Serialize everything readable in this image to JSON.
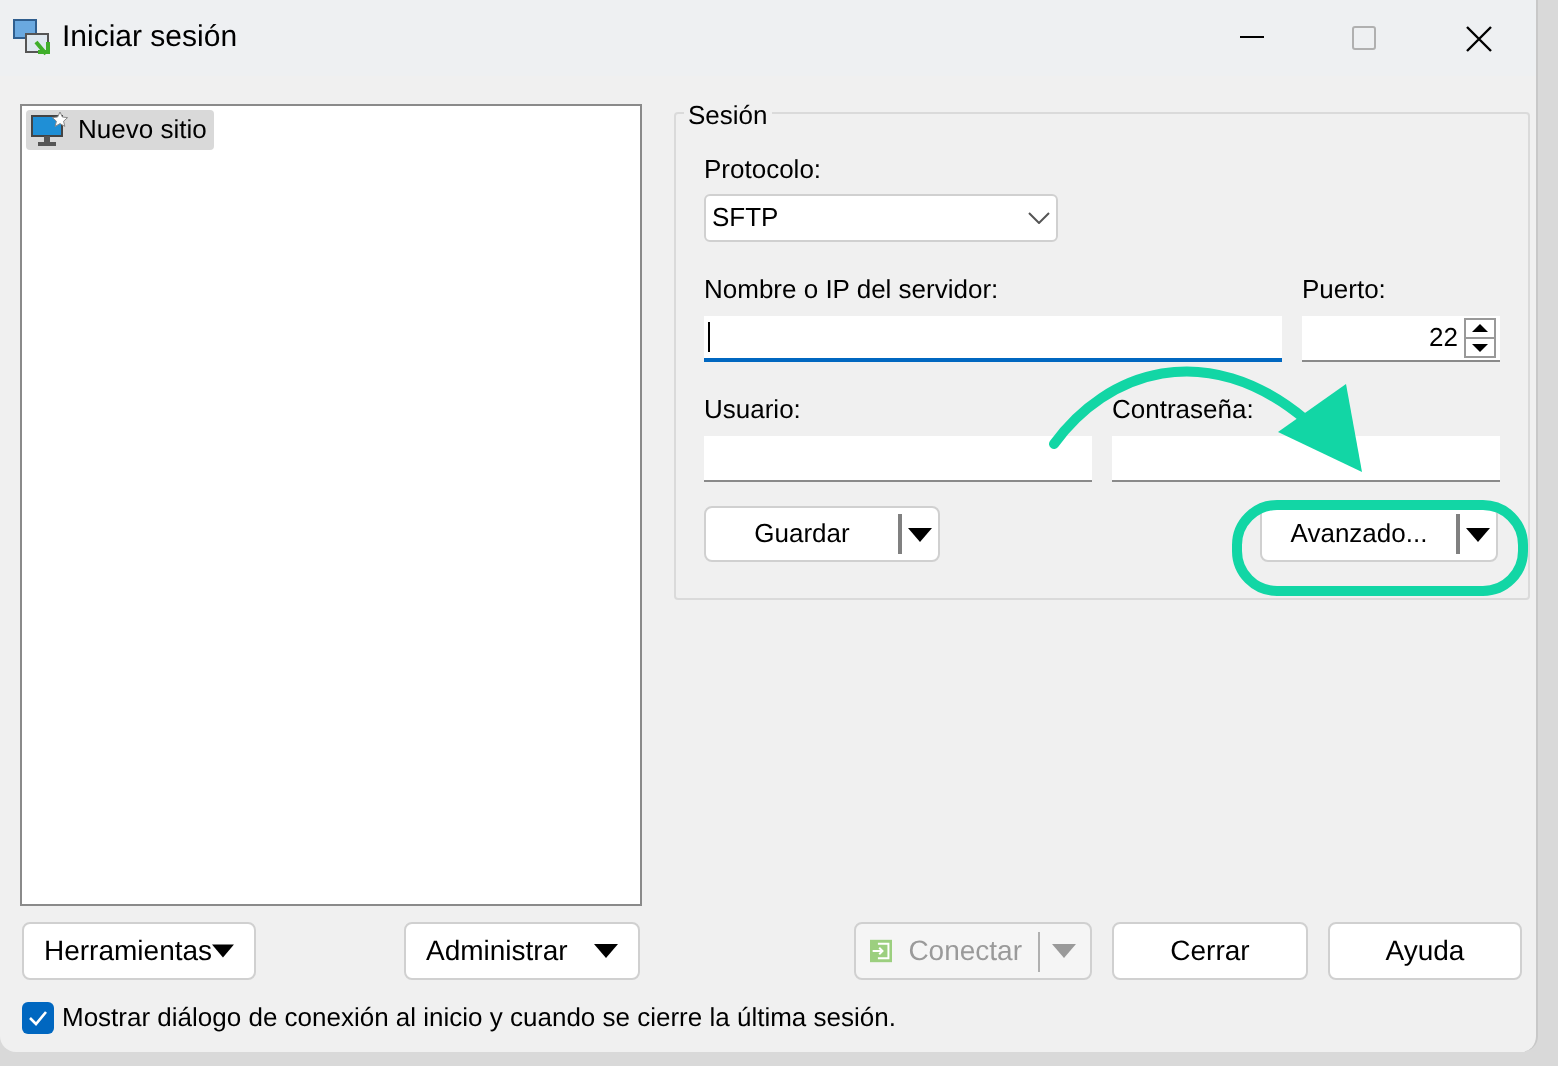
{
  "window": {
    "title": "Iniciar sesión"
  },
  "sites": [
    {
      "label": "Nuevo sitio",
      "selected": true
    }
  ],
  "session": {
    "title": "Sesión",
    "protocol_label": "Protocolo:",
    "protocol": "SFTP",
    "host_label": "Nombre o IP del servidor:",
    "host_focused": true,
    "port_label": "Puerto:",
    "port": "22",
    "user_label": "Usuario:",
    "password_label": "Contraseña:",
    "save_button": "Guardar",
    "advanced_button": "Avanzado...",
    "advanced_highlighted": true
  },
  "bottom_buttons": [
    {
      "label": "Herramientas",
      "kind": "menu",
      "disabled": false
    },
    {
      "label": "Administrar",
      "kind": "menu",
      "disabled": false
    },
    {
      "label": "Conectar",
      "kind": "split",
      "disabled": true
    },
    {
      "label": "Cerrar",
      "kind": "plain",
      "disabled": false
    },
    {
      "label": "Ayuda",
      "kind": "plain",
      "disabled": false
    }
  ],
  "show_dialog": {
    "label": "Mostrar diálogo de conexión al inicio y cuando se cierre la última sesión.",
    "checked": true
  }
}
